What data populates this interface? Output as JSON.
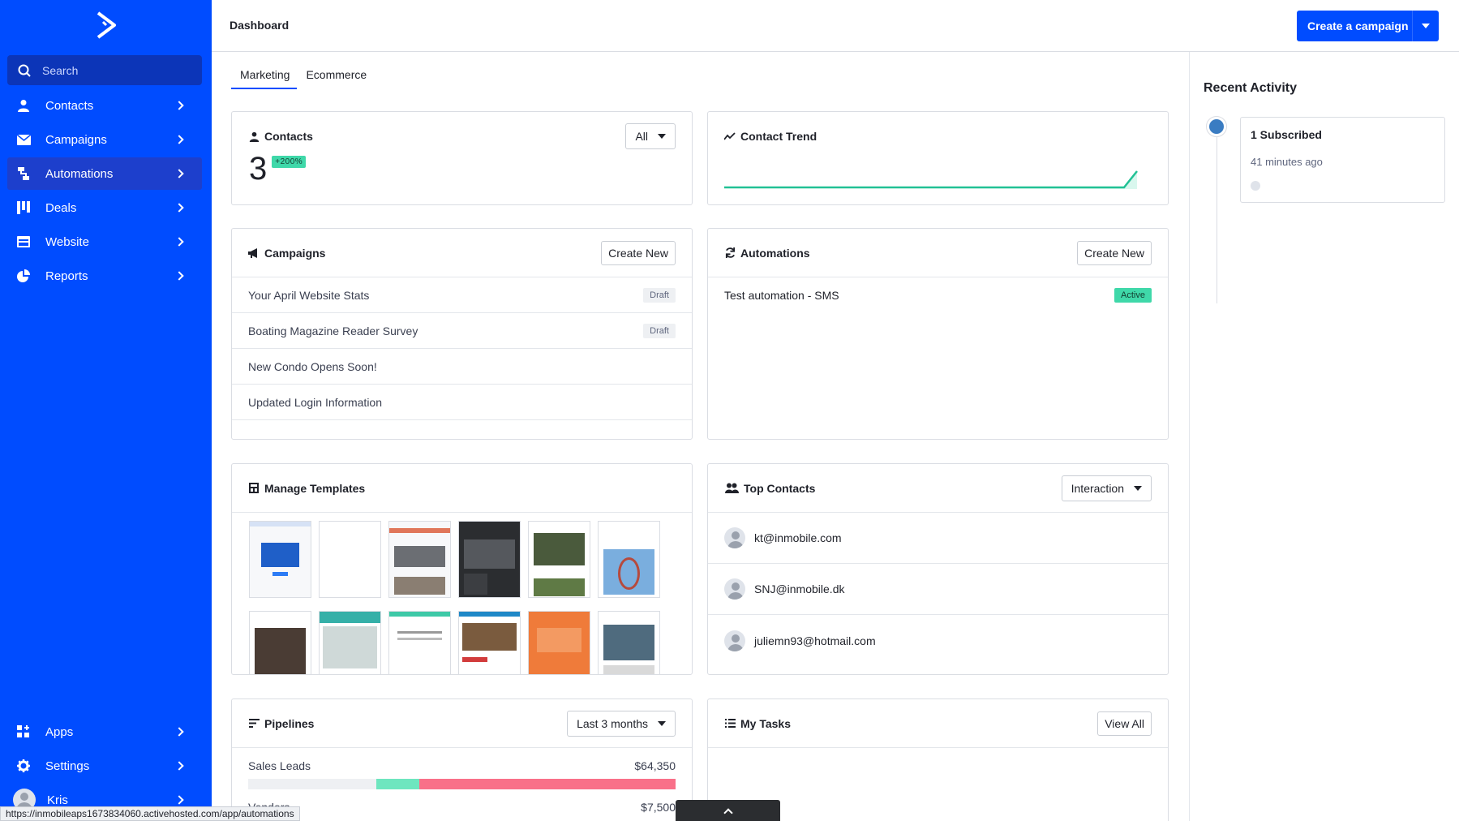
{
  "header": {
    "title": "Dashboard",
    "create_label": "Create a campaign"
  },
  "sidebar": {
    "search_placeholder": "Search",
    "items": [
      {
        "label": "Contacts",
        "icon": "person-icon"
      },
      {
        "label": "Campaigns",
        "icon": "envelope-icon"
      },
      {
        "label": "Automations",
        "icon": "automation-icon"
      },
      {
        "label": "Deals",
        "icon": "pipeline-icon"
      },
      {
        "label": "Website",
        "icon": "browser-icon"
      },
      {
        "label": "Reports",
        "icon": "pie-chart-icon"
      }
    ],
    "bottom_items": [
      {
        "label": "Apps",
        "icon": "grid-plus-icon"
      },
      {
        "label": "Settings",
        "icon": "gear-icon"
      },
      {
        "label": "Kris",
        "icon": "avatar"
      }
    ],
    "accent": "#004cff"
  },
  "tabs": [
    "Marketing",
    "Ecommerce"
  ],
  "contacts_card": {
    "title": "Contacts",
    "value": "3",
    "change": "+200%",
    "filter": "All"
  },
  "trend_card": {
    "title": "Contact Trend"
  },
  "campaigns_card": {
    "title": "Campaigns",
    "button": "Create New",
    "rows": [
      {
        "name": "Your April Website Stats",
        "status": "Draft"
      },
      {
        "name": "Boating Magazine Reader Survey",
        "status": "Draft"
      },
      {
        "name": "New Condo Opens Soon!",
        "status": ""
      },
      {
        "name": "Updated Login Information",
        "status": ""
      }
    ]
  },
  "automations_card": {
    "title": "Automations",
    "button": "Create New",
    "rows": [
      {
        "name": "Test automation - SMS",
        "status": "Active"
      }
    ]
  },
  "templates_card": {
    "title": "Manage Templates"
  },
  "top_contacts_card": {
    "title": "Top Contacts",
    "filter": "Interaction",
    "contacts": [
      "kt@inmobile.com",
      "SNJ@inmobile.dk",
      "juliemn93@hotmail.com"
    ]
  },
  "pipelines_card": {
    "title": "Pipelines",
    "filter": "Last 3 months",
    "rows": [
      {
        "name": "Sales Leads",
        "value": "$64,350"
      },
      {
        "name": "Vendors",
        "value": "$7,500"
      }
    ]
  },
  "tasks_card": {
    "title": "My Tasks",
    "button": "View All"
  },
  "activity": {
    "title": "Recent Activity",
    "items": [
      {
        "title": "1 Subscribed",
        "time": "41 minutes ago"
      }
    ]
  },
  "status_bar": {
    "url": "https://inmobileaps1673834060.activehosted.com/app/automations"
  }
}
